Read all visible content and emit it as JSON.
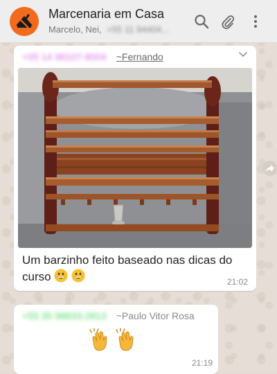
{
  "header": {
    "group_name": "Marcenaria em Casa",
    "members_visible": "Marcelo, Nei,",
    "members_redacted": "+55 11 94404..."
  },
  "messages": [
    {
      "sender_phone_redacted": "+55 14 98107-8004",
      "sender_name": "~Fernando",
      "caption": "Um barzinho feito baseado nas dicas do curso",
      "emoji": [
        "grinning-face",
        "grinning-face"
      ],
      "time": "21:02"
    },
    {
      "sender_phone_redacted": "+55 35 98833-2813",
      "sender_name": "~Paulo Vitor Rosa",
      "emoji": [
        "clapping-hands",
        "clapping-hands"
      ],
      "time": "21:19"
    }
  ],
  "icons": {
    "search": "search-icon",
    "attach": "paperclip-icon",
    "menu": "more-vertical-icon",
    "dropdown": "chevron-down-icon",
    "forward": "forward-icon"
  },
  "colors": {
    "header_bg": "#eeeeee",
    "chat_bg": "#e6ded6",
    "avatar_bg": "#f26b1d",
    "sender_1": "#d86fe6",
    "sender_2": "#4cd964"
  }
}
